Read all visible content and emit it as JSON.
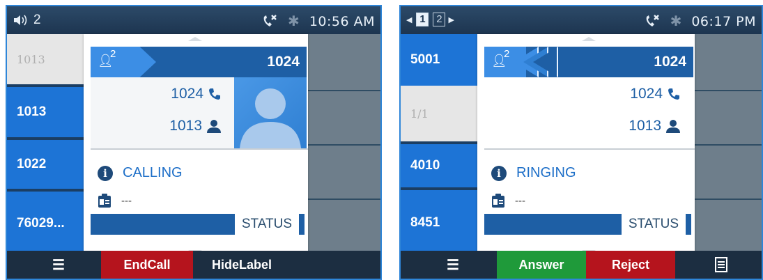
{
  "left": {
    "status": {
      "line_indicator": "2",
      "time": "10:56 AM"
    },
    "sidebar": [
      "1013",
      "1013",
      "1022",
      "76029..."
    ],
    "banner": {
      "count": "2",
      "number": "1024"
    },
    "info": {
      "remote": "1024",
      "local": "1013"
    },
    "call_status": "CALLING",
    "extra": "---",
    "status_tag": "STATUS",
    "softkeys": {
      "end": "EndCall",
      "hide": "HideLabel"
    }
  },
  "right": {
    "status": {
      "page1": "1",
      "page2": "2",
      "time": "06:17 PM"
    },
    "sidebar": [
      "5001",
      "1/1",
      "4010",
      "8451"
    ],
    "banner": {
      "count": "2",
      "number": "1024"
    },
    "info": {
      "remote": "1024",
      "local": "1013"
    },
    "call_status": "RINGING",
    "extra": "---",
    "status_tag": "STATUS",
    "softkeys": {
      "answer": "Answer",
      "reject": "Reject"
    }
  },
  "colors": {
    "accent": "#1d74d6",
    "banner": "#1e5fa5",
    "end_call": "#b5141d",
    "answer": "#1f9a3a",
    "reject": "#b5141d",
    "statusbar": "#1d3550"
  }
}
